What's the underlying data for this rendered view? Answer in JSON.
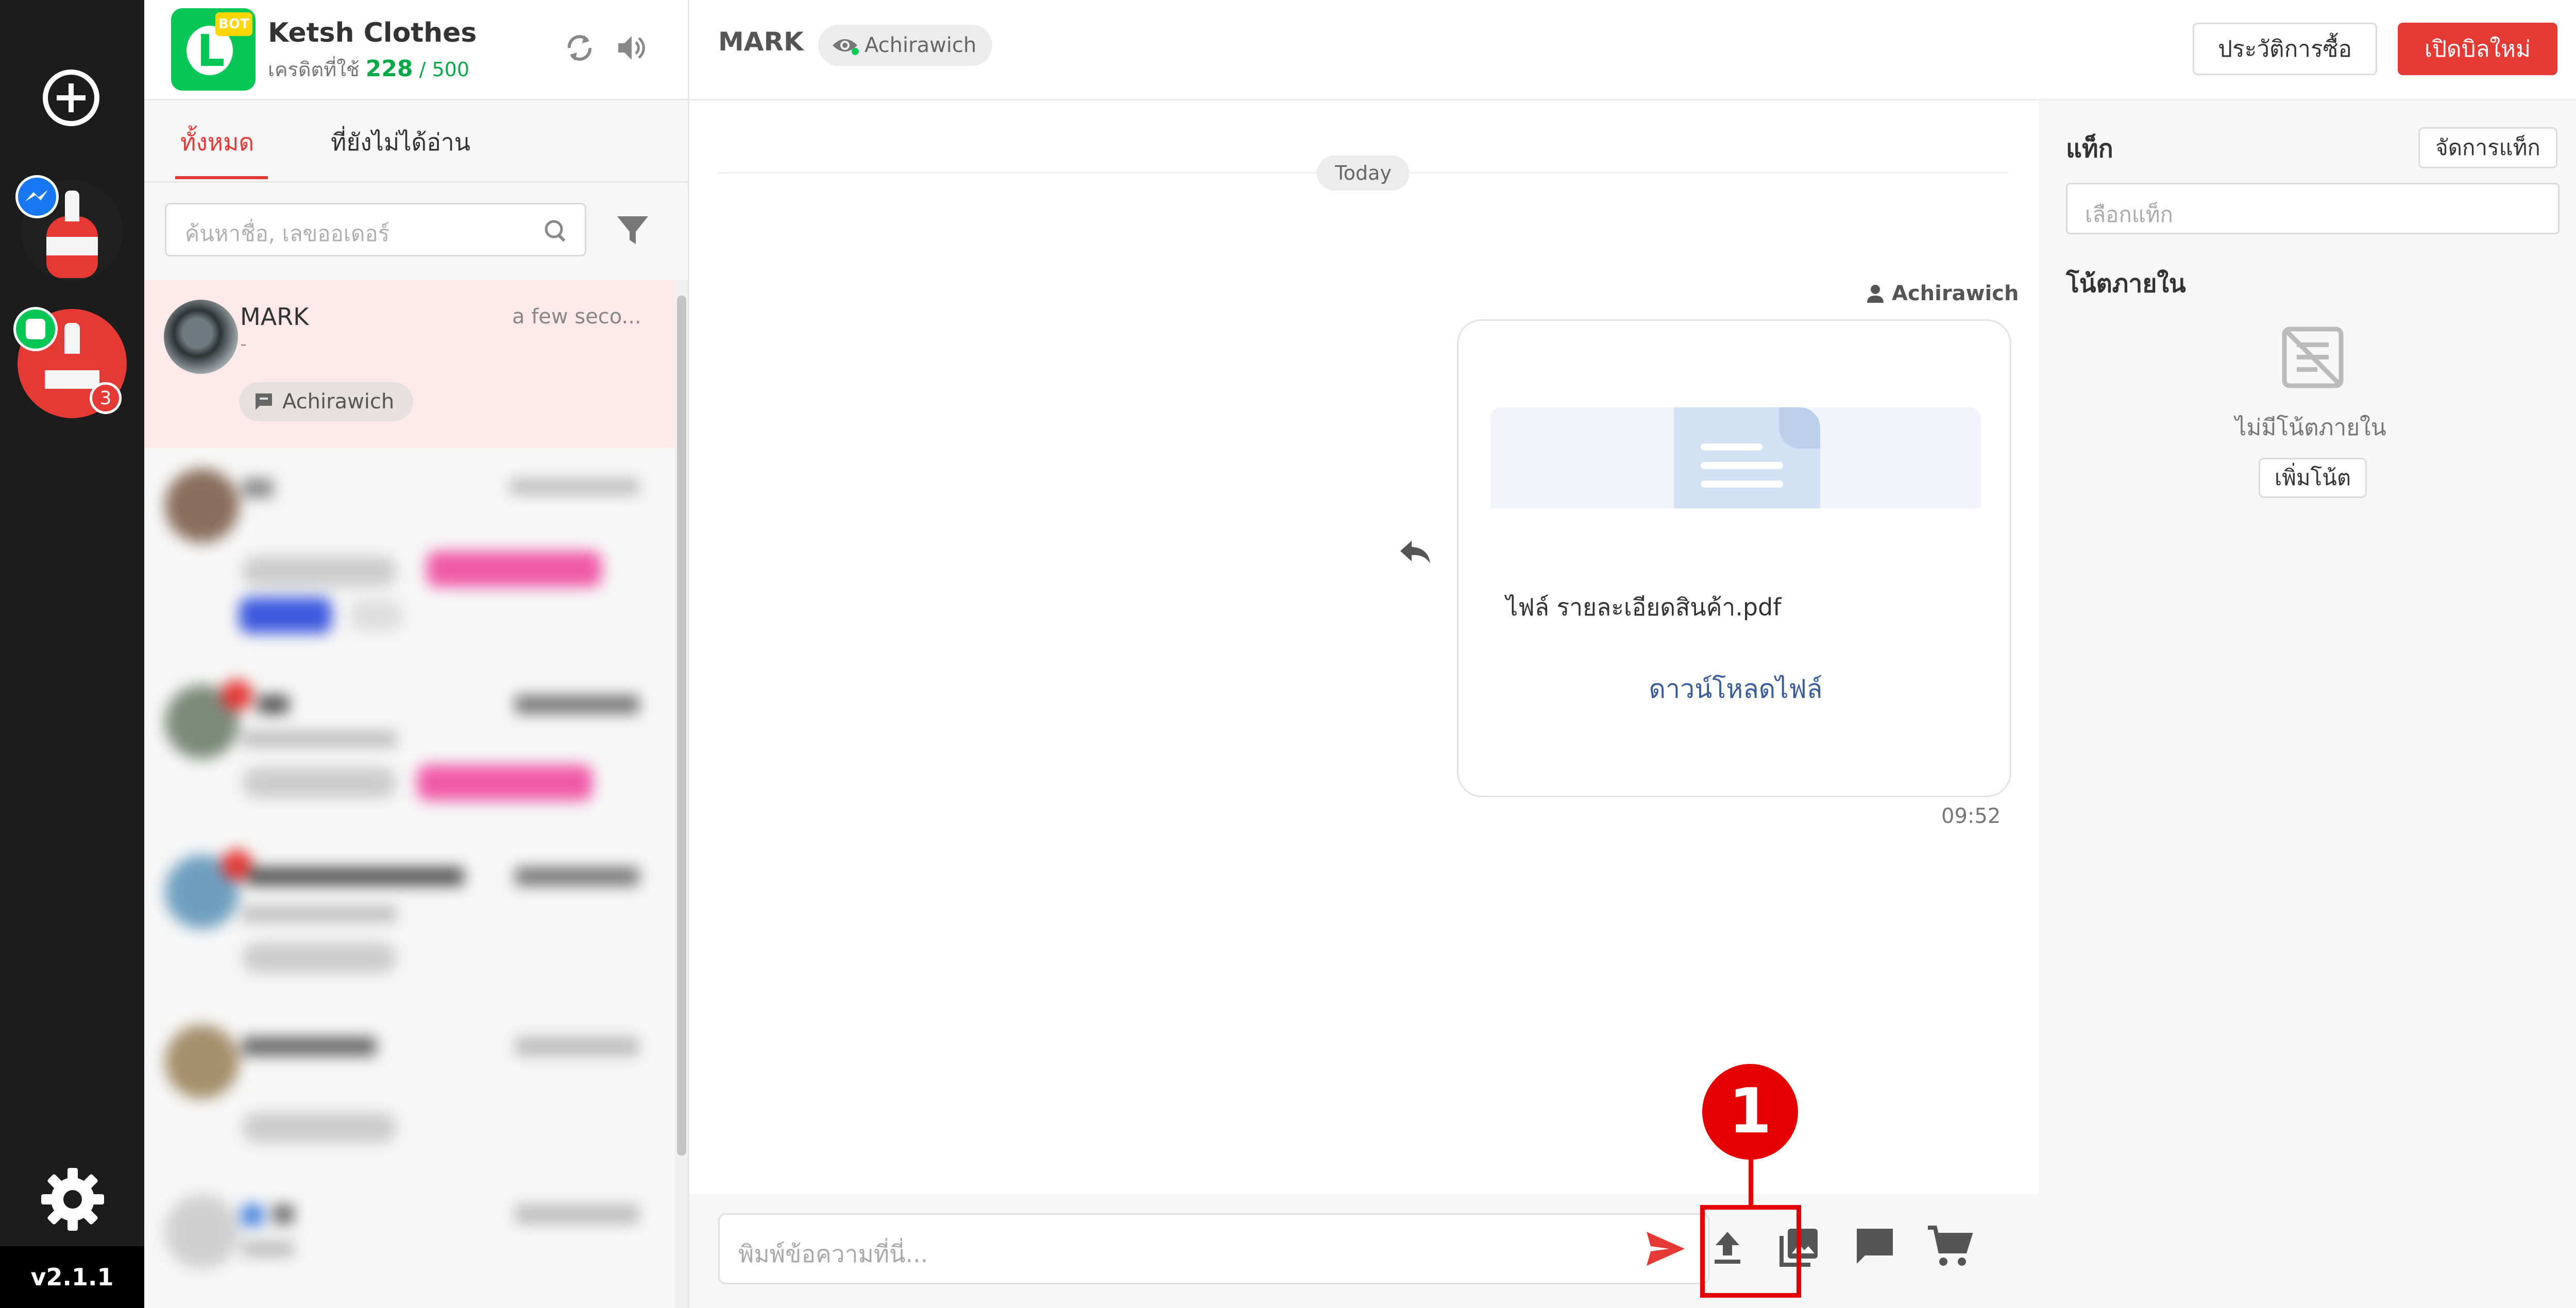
{
  "app": {
    "version": "v2.1.1",
    "shop_name": "Ketsh Clothes",
    "bot_badge": "BOT",
    "credit_label": "เครดิตที่ใช้",
    "credit_used": "228",
    "credit_total": "/ 500"
  },
  "rail": {
    "unread_badge": "3"
  },
  "tabs": [
    {
      "label": "ทั้งหมด",
      "active": true
    },
    {
      "label": "ที่ยังไม่ได้อ่าน",
      "active": false
    }
  ],
  "search": {
    "placeholder": "ค้นหาชื่อ, เลขออเดอร์"
  },
  "conversations": [
    {
      "name": "MARK",
      "time": "a few seco...",
      "preview": "-",
      "assignee": "Achirawich"
    }
  ],
  "chat_header": {
    "customer": "MARK",
    "viewer": "Achirawich",
    "history_button": "ประวัติการซื้อ",
    "new_bill_button": "เปิดบิลใหม่"
  },
  "messages": {
    "date_divider": "Today",
    "sender": "Achirawich",
    "file_name": "ไฟล์ รายละเอียดสินค้า.pdf",
    "download_label": "ดาวน์โหลดไฟล์",
    "time": "09:52"
  },
  "composer": {
    "placeholder": "พิมพ์ข้อความที่นี่..."
  },
  "annotation": {
    "number": "1"
  },
  "sidebar": {
    "tags_title": "แท็ก",
    "manage_tags": "จัดการแท็ก",
    "tag_placeholder": "เลือกแท็ก",
    "notes_title": "โน้ตภายใน",
    "no_notes": "ไม่มีโน้ตภายใน",
    "add_note": "เพิ่มโน้ต"
  },
  "colors": {
    "accent_red": "#e53935",
    "line_green": "#06c755",
    "rail_dark": "#1c1c1c",
    "link_blue": "#3b5b9a"
  }
}
